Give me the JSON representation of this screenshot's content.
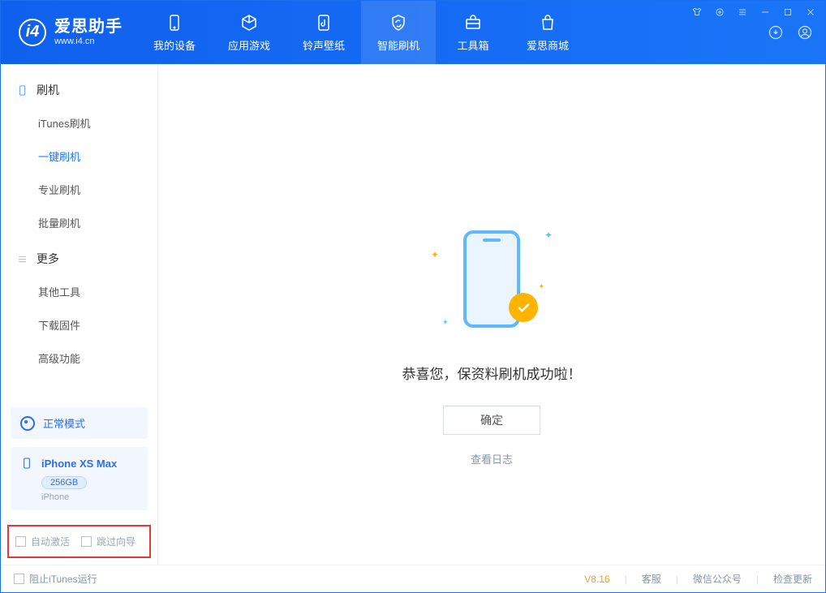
{
  "app": {
    "title": "爱思助手",
    "subtitle": "www.i4.cn"
  },
  "nav": {
    "tabs": [
      {
        "label": "我的设备"
      },
      {
        "label": "应用游戏"
      },
      {
        "label": "铃声壁纸"
      },
      {
        "label": "智能刷机"
      },
      {
        "label": "工具箱"
      },
      {
        "label": "爱思商城"
      }
    ]
  },
  "sidebar": {
    "section_flash": "刷机",
    "flash_items": [
      "iTunes刷机",
      "一键刷机",
      "专业刷机",
      "批量刷机"
    ],
    "section_more": "更多",
    "more_items": [
      "其他工具",
      "下载固件",
      "高级功能"
    ],
    "status_label": "正常模式",
    "device": {
      "name": "iPhone XS Max",
      "capacity": "256GB",
      "type": "iPhone"
    },
    "auto_activate": "自动激活",
    "skip_wizard": "跳过向导"
  },
  "main": {
    "success_message": "恭喜您，保资料刷机成功啦！",
    "ok_button": "确定",
    "view_log": "查看日志"
  },
  "footer": {
    "block_itunes": "阻止iTunes运行",
    "version": "V8.16",
    "links": [
      "客服",
      "微信公众号",
      "检查更新"
    ]
  }
}
